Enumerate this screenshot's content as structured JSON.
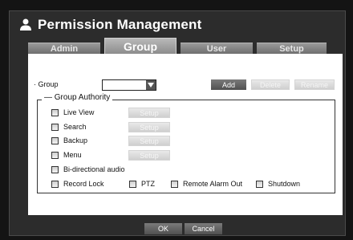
{
  "window": {
    "title": "Permission Management",
    "icon": "user-icon"
  },
  "tabs": [
    {
      "label": "Admin",
      "active": false
    },
    {
      "label": "Group",
      "active": true
    },
    {
      "label": "User",
      "active": false
    },
    {
      "label": "Setup",
      "active": false
    }
  ],
  "group_row": {
    "label": "· Group",
    "selected_value": "",
    "add_label": "Add",
    "delete_label": "Delete",
    "rename_label": "Rename"
  },
  "authority": {
    "legend": "Group Authority",
    "setup_label": "Setup",
    "items": [
      {
        "label": "Live View",
        "checked": false
      },
      {
        "label": "Search",
        "checked": false
      },
      {
        "label": "Backup",
        "checked": false
      },
      {
        "label": "Menu",
        "checked": false
      },
      {
        "label": "Bi-directional audio",
        "checked": false
      },
      {
        "label": "Record Lock",
        "checked": false
      },
      {
        "label": "PTZ",
        "checked": false
      },
      {
        "label": "Remote Alarm Out",
        "checked": false
      },
      {
        "label": "Shutdown",
        "checked": false
      }
    ]
  },
  "footer": {
    "ok_label": "OK",
    "cancel_label": "Cancel"
  },
  "colors": {
    "background": "#141414",
    "frame": "#2c2c2c",
    "panel": "#ffffff",
    "button_dark": "#606060",
    "button_disabled": "#dcdcdc"
  }
}
